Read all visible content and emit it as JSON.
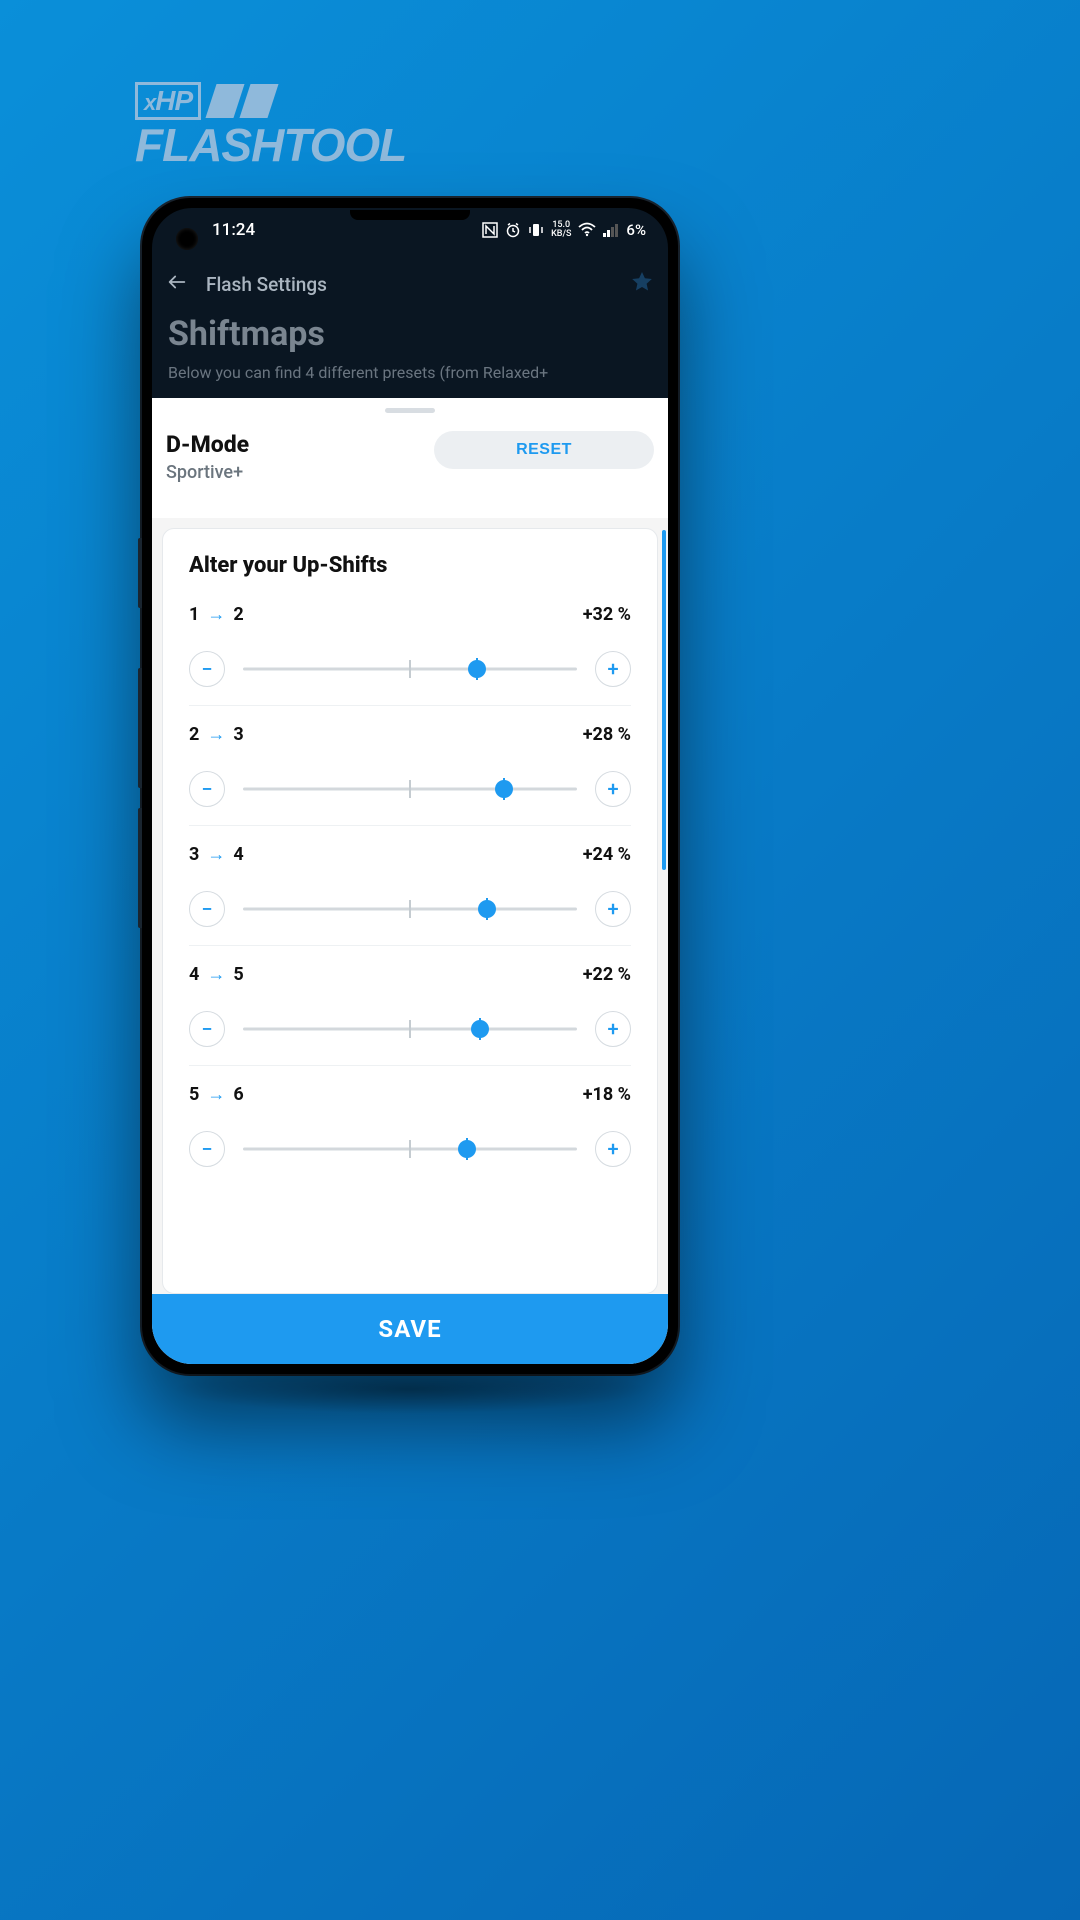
{
  "logo": {
    "badge_prefix": "x",
    "badge_text": "HP",
    "word": "FLASHTOOL"
  },
  "status": {
    "time": "11:24",
    "speed_value": "15.0",
    "speed_unit": "KB/S",
    "battery_pct": "6%"
  },
  "toolbar": {
    "back_screen": "Flash Settings"
  },
  "page": {
    "title": "Shiftmaps",
    "description": "Below you can find 4 different presets (from Relaxed+"
  },
  "sheet": {
    "mode_title": "D-Mode",
    "mode_subtitle": "Sportive+",
    "reset_label": "RESET",
    "card_title": "Alter your Up-Shifts",
    "save_label": "SAVE"
  },
  "shifts": [
    {
      "from": "1",
      "to": "2",
      "value_label": "+32 %",
      "pos": 70
    },
    {
      "from": "2",
      "to": "3",
      "value_label": "+28 %",
      "pos": 78
    },
    {
      "from": "3",
      "to": "4",
      "value_label": "+24 %",
      "pos": 73
    },
    {
      "from": "4",
      "to": "5",
      "value_label": "+22 %",
      "pos": 71
    },
    {
      "from": "5",
      "to": "6",
      "value_label": "+18 %",
      "pos": 67
    }
  ],
  "colors": {
    "accent": "#1e9af0"
  }
}
